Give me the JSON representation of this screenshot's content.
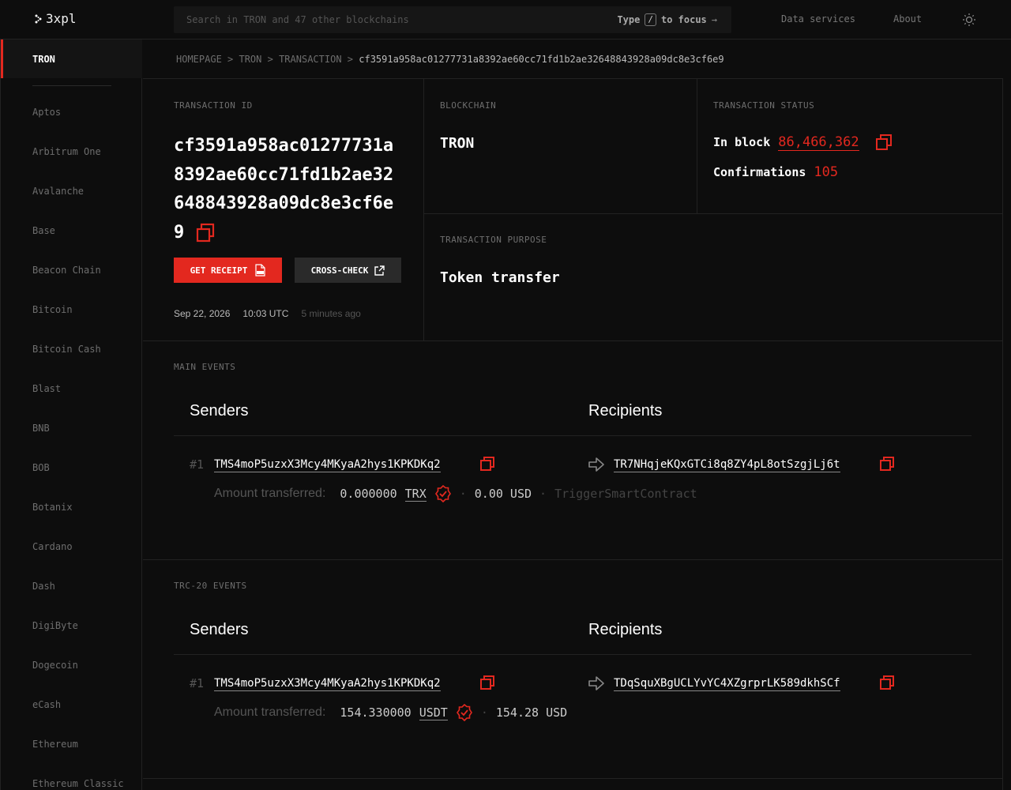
{
  "header": {
    "logo_text": "3xpl",
    "search_placeholder": "Search in TRON and 47 other blockchains",
    "search_hint_type": "Type",
    "search_hint_key": "/",
    "search_hint_focus": "to focus",
    "nav": [
      "Data services",
      "About"
    ]
  },
  "sidebar": {
    "active": "TRON",
    "items": [
      "Aptos",
      "Arbitrum One",
      "Avalanche",
      "Base",
      "Beacon Chain",
      "Bitcoin",
      "Bitcoin Cash",
      "Blast",
      "BNB",
      "BOB",
      "Botanix",
      "Cardano",
      "Dash",
      "DigiByte",
      "Dogecoin",
      "eCash",
      "Ethereum",
      "Ethereum Classic"
    ]
  },
  "breadcrumb": {
    "items": [
      "HOMEPAGE",
      "TRON",
      "TRANSACTION"
    ],
    "current": "cf3591a958ac01277731a8392ae60cc71fd1b2ae32648843928a09dc8e3cf6e9"
  },
  "transaction": {
    "id_label": "TRANSACTION ID",
    "id": "cf3591a958ac01277731a8392ae60cc71fd1b2ae32648843928a09dc8e3cf6e9",
    "receipt_button": "GET RECEIPT",
    "crosscheck_button": "CROSS-CHECK",
    "date": "Sep 22, 2026",
    "time": "10:03 UTC",
    "ago": "5 minutes ago",
    "blockchain_label": "BLOCKCHAIN",
    "blockchain": "TRON",
    "status_label": "TRANSACTION STATUS",
    "in_block_label": "In block",
    "block": "86,466,362",
    "confirmations_label": "Confirmations",
    "confirmations": "105",
    "purpose_label": "TRANSACTION PURPOSE",
    "purpose": "Token transfer"
  },
  "main_events": {
    "label": "MAIN EVENTS",
    "senders_heading": "Senders",
    "recipients_heading": "Recipients",
    "index": "#1",
    "sender": "TMS4moP5uzxX3Mcy4MKyaA2hys1KPKDKq2",
    "recipient": "TR7NHqjeKQxGTCi8q8ZY4pL8otSzgjLj6t",
    "amount_label": "Amount transferred:",
    "amount": "0.000000",
    "token": "TRX",
    "usd": "0.00 USD",
    "method": "TriggerSmartContract"
  },
  "trc20_events": {
    "label": "TRC-20 EVENTS",
    "senders_heading": "Senders",
    "recipients_heading": "Recipients",
    "index": "#1",
    "sender": "TMS4moP5uzxX3Mcy4MKyaA2hys1KPKDKq2",
    "recipient": "TDqSquXBgUCLYvYC4XZgrprLK589dkhSCf",
    "amount_label": "Amount transferred:",
    "amount": "154.330000",
    "token": "USDT",
    "usd": "154.28 USD"
  },
  "colors": {
    "accent": "#e3281f",
    "background": "#0d0d0d"
  }
}
